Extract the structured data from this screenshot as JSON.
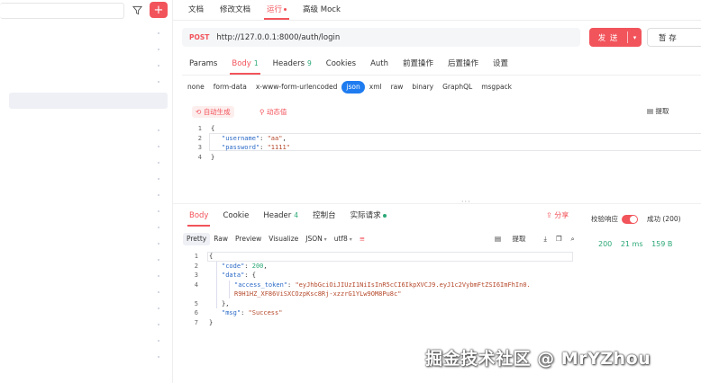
{
  "sidebar": {
    "add_label": "+"
  },
  "top_tabs": [
    "文档",
    "修改文档",
    "运行",
    "高级 Mock"
  ],
  "request": {
    "method": "POST",
    "url": "http://127.0.0.1:8000/auth/login",
    "send_label": "发 送",
    "save_label": "暂 存"
  },
  "req_tabs": [
    {
      "label": "Params",
      "count": ""
    },
    {
      "label": "Body",
      "count": "1"
    },
    {
      "label": "Headers",
      "count": "9"
    },
    {
      "label": "Cookies",
      "count": ""
    },
    {
      "label": "Auth",
      "count": ""
    },
    {
      "label": "前置操作",
      "count": ""
    },
    {
      "label": "后置操作",
      "count": ""
    },
    {
      "label": "设置",
      "count": ""
    }
  ],
  "body_types": [
    "none",
    "form-data",
    "x-www-form-urlencoded",
    "json",
    "xml",
    "raw",
    "binary",
    "GraphQL",
    "msgpack"
  ],
  "body_toolbar": {
    "auto_gen": "自动生成",
    "dynamic": "动态值",
    "extract": "提取"
  },
  "request_body": [
    {
      "n": "1",
      "text": "{"
    },
    {
      "n": "2",
      "key": "\"username\"",
      "val": "\"aa\"",
      "tail": ","
    },
    {
      "n": "3",
      "key": "\"password\"",
      "val": "\"1111\"",
      "tail": ""
    },
    {
      "n": "4",
      "text": "}"
    }
  ],
  "resp_tabs": [
    {
      "label": "Body",
      "count": ""
    },
    {
      "label": "Cookie",
      "count": ""
    },
    {
      "label": "Header",
      "count": "4"
    },
    {
      "label": "控制台",
      "count": ""
    },
    {
      "label": "实际请求",
      "count": ""
    }
  ],
  "resp_actions": {
    "share": "分享",
    "verify": "校验响应",
    "status": "成功 (200)"
  },
  "formats": [
    "Pretty",
    "Raw",
    "Preview",
    "Visualize",
    "JSON",
    "utf8"
  ],
  "resp_tools": {
    "extract": "提取"
  },
  "metrics": {
    "status": "200",
    "time": "21 ms",
    "size": "159 B"
  },
  "response_body": {
    "l1": "{",
    "code_key": "\"code\"",
    "code_val": "200",
    "data_key": "\"data\"",
    "token_key": "\"access_token\"",
    "token_val1": "\"eyJhbGciOiJIUzI1NiIsInR5cCI6IkpXVCJ9.eyJ1c2VybmFtZSI6ImFhIn0.",
    "token_val2": "R9H1HZ_XF86ViSXCOzpKsc8Rj-xzzrG1YLw9OM8Pu8c\"",
    "l5": "},",
    "msg_key": "\"msg\"",
    "msg_val": "\"Success\"",
    "l7": "}"
  },
  "watermark": "掘金技术社区 @ MrYZhou"
}
